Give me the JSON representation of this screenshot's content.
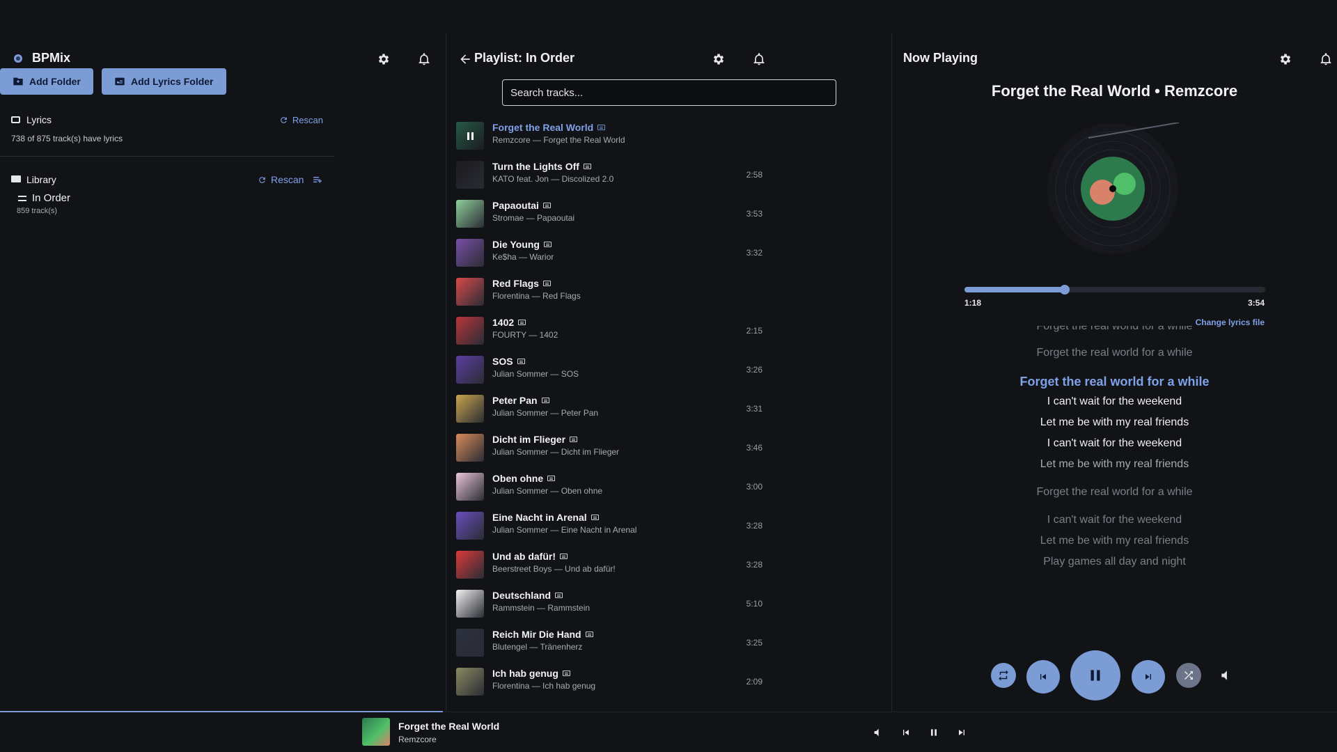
{
  "app": {
    "name": "BPMix"
  },
  "left": {
    "add_folder_label": "Add Folder",
    "add_lyrics_folder_label": "Add Lyrics Folder",
    "lyrics_section": {
      "title": "Lyrics",
      "rescan_label": "Rescan",
      "status": "738 of 875 track(s) have lyrics"
    },
    "library_section": {
      "title": "Library",
      "rescan_label": "Rescan"
    },
    "playlists": [
      {
        "name": "In Order",
        "count": "859 track(s)"
      }
    ]
  },
  "middle": {
    "title": "Playlist: In Order",
    "search_placeholder": "Search tracks...",
    "tracks": [
      {
        "title": "Forget the Real World",
        "subtitle": "Remzcore — Forget the Real World",
        "duration": "",
        "playing": true,
        "color": "#3a8a6a"
      },
      {
        "title": "Turn the Lights Off",
        "subtitle": "KATO feat. Jon — Discolized 2.0",
        "duration": "2:58",
        "color": "#1b1b1f"
      },
      {
        "title": "Papaoutai",
        "subtitle": "Stromae — Papaoutai",
        "duration": "3:53",
        "color": "#8fcf9a"
      },
      {
        "title": "Die Young",
        "subtitle": "Ke$ha — Warior",
        "duration": "3:32",
        "color": "#7a4fa8"
      },
      {
        "title": "Red Flags",
        "subtitle": "Florentina — Red Flags",
        "duration": "",
        "color": "#d94a4a"
      },
      {
        "title": "1402",
        "subtitle": "FOURTY — 1402",
        "duration": "2:15",
        "color": "#b8363a"
      },
      {
        "title": "SOS",
        "subtitle": "Julian Sommer — SOS",
        "duration": "3:26",
        "color": "#5a3da0"
      },
      {
        "title": "Peter Pan",
        "subtitle": "Julian Sommer — Peter Pan",
        "duration": "3:31",
        "color": "#c9a44c"
      },
      {
        "title": "Dicht im Flieger",
        "subtitle": "Julian Sommer — Dicht im Flieger",
        "duration": "3:46",
        "color": "#d98a5a"
      },
      {
        "title": "Oben ohne",
        "subtitle": "Julian Sommer — Oben ohne",
        "duration": "3:00",
        "color": "#e9c5d8"
      },
      {
        "title": "Eine Nacht in Arenal",
        "subtitle": "Julian Sommer — Eine Nacht in Arenal",
        "duration": "3:28",
        "color": "#6a4fc0"
      },
      {
        "title": "Und ab dafür!",
        "subtitle": "Beerstreet Boys — Und ab dafür!",
        "duration": "3:28",
        "color": "#d93b3b"
      },
      {
        "title": "Deutschland",
        "subtitle": "Rammstein — Rammstein",
        "duration": "5:10",
        "color": "#f2f2f2"
      },
      {
        "title": "Reich Mir Die Hand",
        "subtitle": "Blutengel — Tränenherz",
        "duration": "3:25",
        "color": "#2c3140"
      },
      {
        "title": "Ich hab genug",
        "subtitle": "Florentina — Ich hab genug",
        "duration": "2:09",
        "color": "#8a8a60"
      }
    ]
  },
  "right": {
    "title": "Now Playing",
    "track_heading": "Forget the Real World • Remzcore",
    "position": "1:18",
    "length": "3:54",
    "progress_fraction": 0.333,
    "change_lyrics_label": "Change lyrics file",
    "lyrics": [
      {
        "text": "Forget the real world for a while",
        "style": "dim"
      },
      {
        "text": "Forget the real world for a while",
        "style": "dim"
      },
      {
        "text": "Forget the real world for a while",
        "style": "cur"
      },
      {
        "text": "I can't wait for the weekend",
        "style": "now"
      },
      {
        "text": "Let me be with my real friends",
        "style": "now"
      },
      {
        "text": "I can't wait for the weekend",
        "style": "now"
      },
      {
        "text": "Let me be with my real friends",
        "style": "mid"
      },
      {
        "text": "Forget the real world for a while",
        "style": "dim"
      },
      {
        "text": "I can't wait for the weekend",
        "style": "dim"
      },
      {
        "text": "Let me be with my real friends",
        "style": "dim"
      },
      {
        "text": "Play games all day and night",
        "style": "dim"
      }
    ]
  },
  "bottom": {
    "title": "Forget the Real World",
    "artist": "Remzcore"
  },
  "colors": {
    "accent": "#7c9cd6",
    "background": "#121317",
    "link": "#7ea2e8"
  }
}
